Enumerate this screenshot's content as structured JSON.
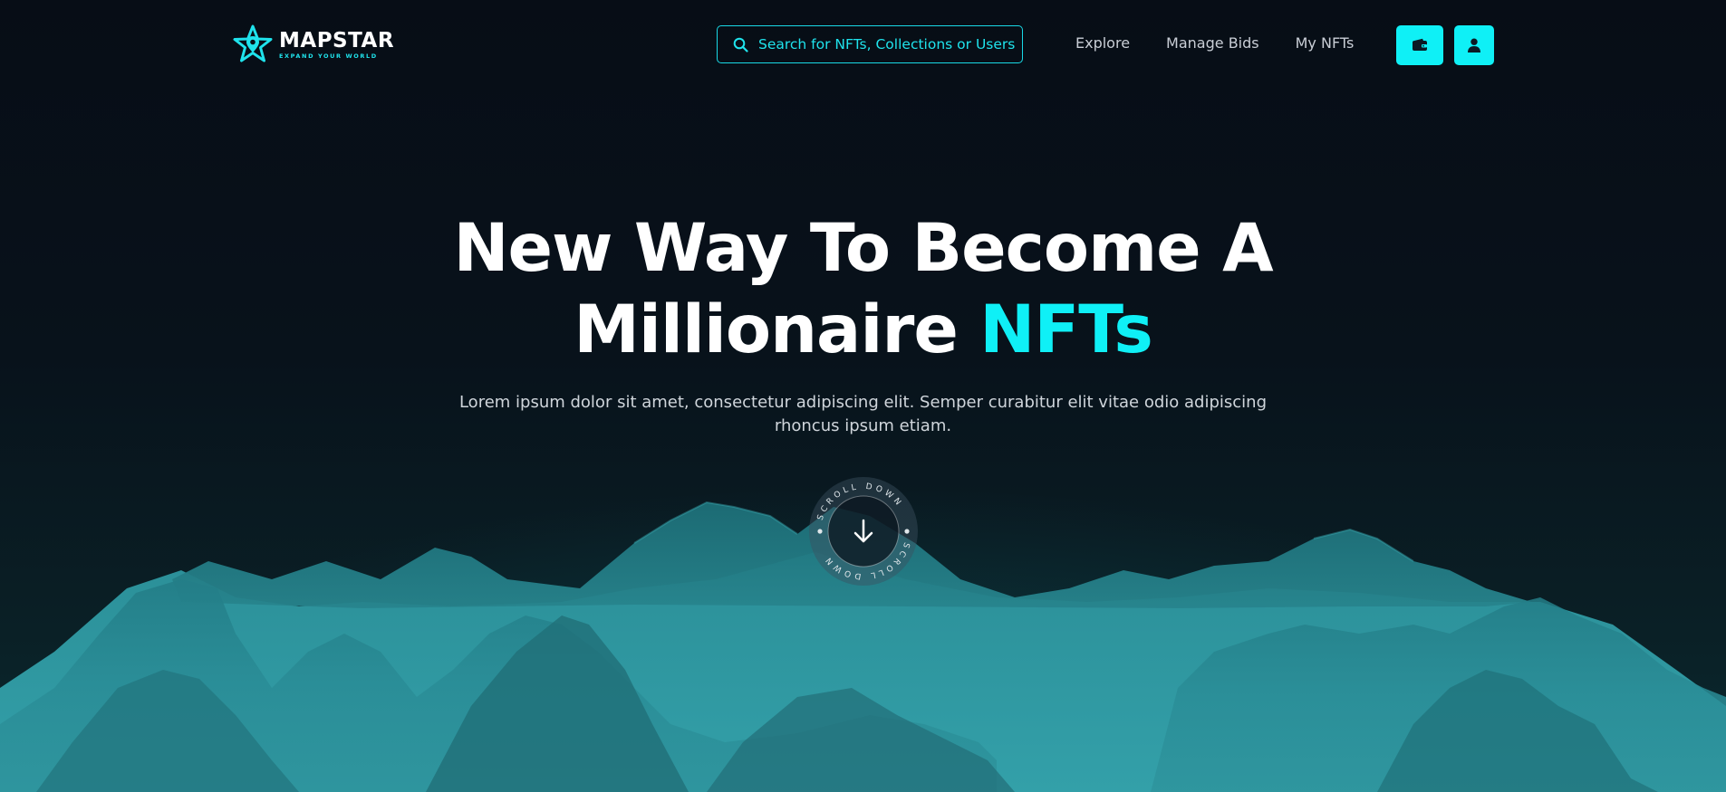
{
  "brand": {
    "name": "MAPSTAR",
    "tagline": "EXPAND YOUR WORLD",
    "logo_icon": "star-pin-icon"
  },
  "header": {
    "search": {
      "placeholder": "Search for NFTs, Collections or Users",
      "value": ""
    },
    "nav": [
      {
        "label": "Explore"
      },
      {
        "label": "Manage Bids"
      },
      {
        "label": "My NFTs"
      }
    ],
    "buttons": {
      "wallet_icon": "wallet-icon",
      "user_icon": "user-icon"
    }
  },
  "hero": {
    "title_line1": "New Way To Become A",
    "title_line2_main": "Millionaire ",
    "title_line2_accent": "NFTs",
    "subtitle": "Lorem ipsum dolor sit amet, consectetur adipiscing elit. Semper curabitur elit vitae odio adipiscing rhoncus ipsum etiam.",
    "scroll_label": "SCROLL DOWN"
  },
  "colors": {
    "accent": "#0ff0f6",
    "background": "#070d16",
    "terrain": "#2b8c96"
  }
}
